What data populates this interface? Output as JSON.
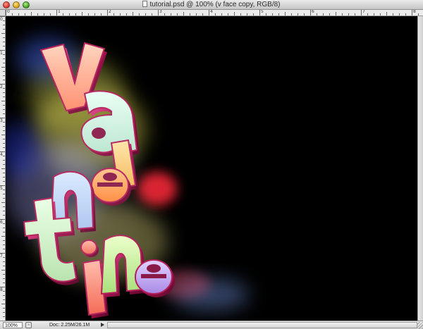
{
  "window": {
    "title": "tutorial.psd @ 100% (v face copy, RGB/8)"
  },
  "rulers": {
    "top_numbers": [
      "0",
      "1",
      "2",
      "3",
      "4",
      "5",
      "6",
      "7",
      "8"
    ],
    "left_numbers": [
      "0",
      "1",
      "2",
      "3",
      "4",
      "5",
      "6",
      "7",
      "8"
    ]
  },
  "artwork": {
    "description_icon": "valentine-3d-text-artwork",
    "letters": [
      "V",
      "a",
      "l",
      "e",
      "n",
      "t",
      "i",
      "n",
      "e"
    ]
  },
  "statusbar": {
    "zoom": "100%",
    "doc_info": "Doc: 2.25M/26.1M"
  },
  "colors": {
    "canvas_background": "#000000",
    "chrome": "#d6d6d6"
  }
}
